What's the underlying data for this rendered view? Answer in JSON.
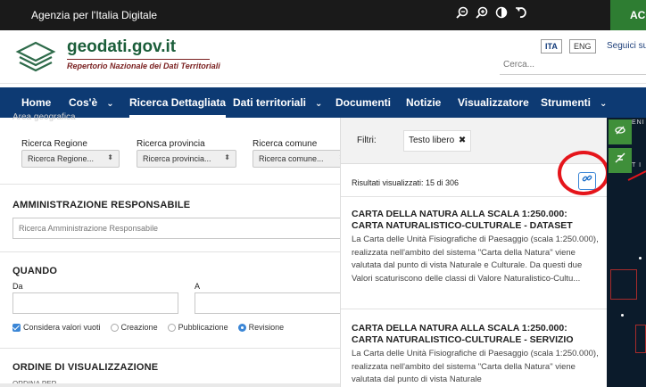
{
  "topbar": {
    "agency": "Agenzia per l'Italia Digitale",
    "tools": [
      "zoom-out-icon",
      "zoom-in-icon",
      "contrast-icon",
      "reset-icon"
    ],
    "access_label": "ACCI"
  },
  "header": {
    "site_title": "geodati.gov.it",
    "site_subtitle": "Repertorio Nazionale dei Dati Territoriali",
    "lang_ita": "ITA",
    "lang_eng": "ENG",
    "follow": "Seguici su",
    "search_placeholder": "Cerca..."
  },
  "nav": {
    "items": [
      "Home",
      "Cos'è",
      "Ricerca Dettagliata",
      "Dati territoriali",
      "Documenti",
      "Notizie",
      "Visualizzatore",
      "Strumenti"
    ],
    "chevron": "⌄"
  },
  "left": {
    "ghost_tab": "Area geografica",
    "region_label": "Ricerca Regione",
    "region_value": "Ricerca Regione...",
    "province_label": "Ricerca provincia",
    "province_value": "Ricerca provincia...",
    "comune_label": "Ricerca comune",
    "comune_value": "Ricerca comune...",
    "admin_title": "AMMINISTRAZIONE RESPONSABILE",
    "admin_placeholder": "Ricerca Amministrazione Responsabile",
    "when_title": "QUANDO",
    "from_label": "Da",
    "to_label": "A",
    "consider_empty": "Considera valori vuoti",
    "radio_creation": "Creazione",
    "radio_publication": "Pubblicazione",
    "radio_revision": "Revisione",
    "order_title": "ORDINE DI VISUALIZZAZIONE",
    "order_by": "ORDINA PER"
  },
  "results": {
    "filter_label": "Filtri:",
    "filter_chip": "Testo libero",
    "filter_remove": "✖",
    "count": "Risultati visualizzati: 15 di 306",
    "link_icon": "🔗",
    "items": [
      {
        "title": "CARTA DELLA NATURA ALLA SCALA 1:250.000: CARTA NATURALISTICO-CULTURALE - DATASET",
        "desc": "La Carta delle Unità Fisiografiche di Paesaggio (scala 1:250.000), realizzata nell'ambito del sistema \"Carta della Natura\" viene valutata dal punto di vista Naturale e Culturale. Da questi due Valori scaturiscono delle classi di Valore Naturalistico-Cultu..."
      },
      {
        "title": "CARTA DELLA NATURA ALLA SCALA 1:250.000: CARTA NATURALISTICO-CULTURALE - SERVIZIO",
        "desc": "La Carta delle Unità Fisiografiche di Paesaggio (scala 1:250.000), realizzata nell'ambito del sistema \"Carta della Natura\" viene valutata dal punto di vista Naturale"
      }
    ]
  },
  "map": {
    "label_top": "ENI",
    "label_mid": "T I"
  },
  "colors": {
    "nav": "#0d3a73",
    "accent_green": "#3f8f3a",
    "highlight": "#e5151b",
    "brand_green": "#1b5e3a"
  }
}
